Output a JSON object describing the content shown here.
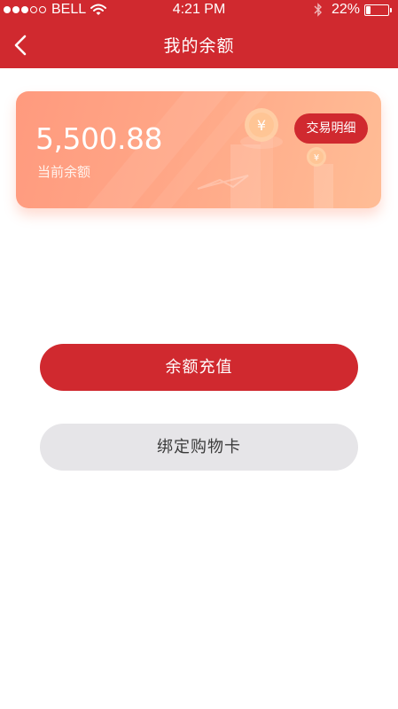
{
  "status_bar": {
    "carrier": "BELL",
    "time": "4:21 PM",
    "battery_percent": "22%",
    "battery_level": 0.22,
    "signal_strength": 3,
    "signal_max": 5
  },
  "nav": {
    "title": "我的余额",
    "back_icon": "chevron-left-icon"
  },
  "balance_card": {
    "amount": "5,500.88",
    "caption": "当前余额",
    "detail_button_label": "交易明细",
    "decoration_icon": "yuan-coin-icon"
  },
  "actions": {
    "recharge_label": "余额充值",
    "bind_card_label": "绑定购物卡"
  },
  "colors": {
    "brand_red": "#d0292f",
    "card_gradient_start": "#ff9a7e",
    "card_gradient_end": "#ffbd96",
    "secondary_button_bg": "#e6e5e8"
  }
}
